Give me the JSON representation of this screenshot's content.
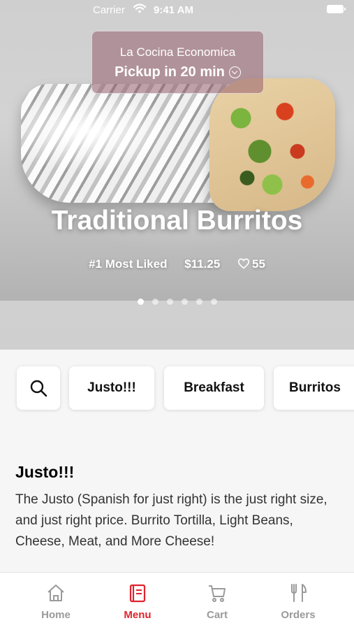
{
  "status_bar": {
    "carrier": "Carrier",
    "time": "9:41 AM"
  },
  "pickup": {
    "restaurant": "La Cocina Economica",
    "label": "Pickup in 20 min"
  },
  "hero": {
    "title": "Traditional Burritos",
    "rank": "#1 Most Liked",
    "price": "$11.25",
    "likes": "55",
    "carousel": {
      "total": 6,
      "active": 1
    }
  },
  "categories": [
    "Justo!!!",
    "Breakfast",
    "Burritos"
  ],
  "section": {
    "title": "Justo!!!",
    "description": "The Justo (Spanish for just right) is the just right size, and just right price. Burrito Tortilla, Light Beans, Cheese, Meat, and More Cheese!"
  },
  "tabbar": {
    "items": [
      {
        "label": "Home",
        "icon": "home-icon"
      },
      {
        "label": "Menu",
        "icon": "menu-icon"
      },
      {
        "label": "Cart",
        "icon": "cart-icon"
      },
      {
        "label": "Orders",
        "icon": "fork-knife-icon"
      }
    ],
    "active": "Menu"
  },
  "colors": {
    "accent": "#e0242e",
    "inactive": "#9a9a9a",
    "pickup_badge": "#965f6e"
  }
}
